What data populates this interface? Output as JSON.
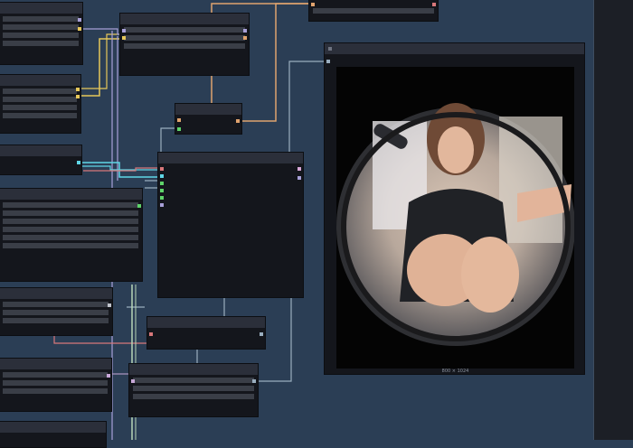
{
  "preview": {
    "caption": "800 × 1024"
  },
  "colors": {
    "background": "#2b3e55",
    "node_body": "#14161c",
    "node_header": "#2b2f3a",
    "link_orange": "#e0a36e",
    "link_yellow": "#e6c75a",
    "link_cyan": "#5fd6e6",
    "link_purple": "#a8a0d8",
    "link_pink": "#d8777a",
    "link_gray": "#9aaebf",
    "port_green": "#5fd46a"
  }
}
